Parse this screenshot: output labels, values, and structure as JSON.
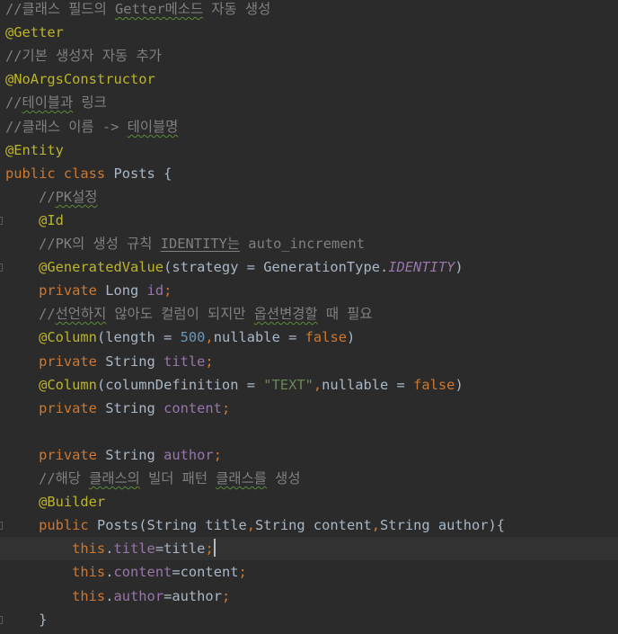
{
  "editor": {
    "theme": {
      "background": "#2b2b2b",
      "current_line": "#323232"
    },
    "lines": [
      {
        "parts": [
          {
            "c": "cm",
            "t": "//클래스 필드의 "
          },
          {
            "c": "cm typo",
            "t": "Getter메소드"
          },
          {
            "c": "cm",
            "t": " 자동 생성"
          }
        ]
      },
      {
        "parts": [
          {
            "c": "an",
            "t": "@Getter"
          }
        ]
      },
      {
        "parts": [
          {
            "c": "cm",
            "t": "//기본 생성자 자동 추가"
          }
        ]
      },
      {
        "parts": [
          {
            "c": "an",
            "t": "@NoArgsConstructor"
          }
        ]
      },
      {
        "parts": [
          {
            "c": "cm",
            "t": "//"
          },
          {
            "c": "cm typo",
            "t": "테이블과"
          },
          {
            "c": "cm",
            "t": " 링크"
          }
        ]
      },
      {
        "parts": [
          {
            "c": "cm",
            "t": "//클래스 이름 -> "
          },
          {
            "c": "cm typo",
            "t": "테이블명"
          }
        ]
      },
      {
        "parts": [
          {
            "c": "an",
            "t": "@Entity"
          }
        ]
      },
      {
        "parts": [
          {
            "c": "kw",
            "t": "public class "
          },
          {
            "c": "pl",
            "t": "Posts {"
          }
        ]
      },
      {
        "parts": [
          {
            "c": "cm",
            "t": "    //"
          },
          {
            "c": "cm typo",
            "t": "PK설정"
          }
        ]
      },
      {
        "gutter": true,
        "parts": [
          {
            "c": "an",
            "t": "    @Id"
          }
        ]
      },
      {
        "parts": [
          {
            "c": "cm",
            "t": "    //PK의 생성 규칙 "
          },
          {
            "c": "cm un",
            "t": "IDENTITY는"
          },
          {
            "c": "cm",
            "t": " auto_increment"
          }
        ]
      },
      {
        "gutter": true,
        "parts": [
          {
            "c": "an",
            "t": "    @GeneratedValue"
          },
          {
            "c": "pl",
            "t": "(strategy = GenerationType."
          },
          {
            "c": "it",
            "t": "IDENTITY"
          },
          {
            "c": "pl",
            "t": ")"
          }
        ]
      },
      {
        "parts": [
          {
            "c": "kw",
            "t": "    private "
          },
          {
            "c": "pl",
            "t": "Long "
          },
          {
            "c": "fd",
            "t": "id"
          },
          {
            "c": "kw",
            "t": ";"
          }
        ]
      },
      {
        "parts": [
          {
            "c": "cm",
            "t": "    //"
          },
          {
            "c": "cm typo",
            "t": "선언하지"
          },
          {
            "c": "cm",
            "t": " 않아도 컬럼이 되지만 "
          },
          {
            "c": "cm typo",
            "t": "옵션변경할"
          },
          {
            "c": "cm",
            "t": " 때 필요"
          }
        ]
      },
      {
        "parts": [
          {
            "c": "an",
            "t": "    @Column"
          },
          {
            "c": "pl",
            "t": "(length = "
          },
          {
            "c": "nu",
            "t": "500"
          },
          {
            "c": "kw",
            "t": ","
          },
          {
            "c": "pl",
            "t": "nullable = "
          },
          {
            "c": "kw",
            "t": "false"
          },
          {
            "c": "pl",
            "t": ")"
          }
        ]
      },
      {
        "parts": [
          {
            "c": "kw",
            "t": "    private "
          },
          {
            "c": "pl",
            "t": "String "
          },
          {
            "c": "fd",
            "t": "title"
          },
          {
            "c": "kw",
            "t": ";"
          }
        ]
      },
      {
        "parts": [
          {
            "c": "an",
            "t": "    @Column"
          },
          {
            "c": "pl",
            "t": "(columnDefinition = "
          },
          {
            "c": "st",
            "t": "\"TEXT\""
          },
          {
            "c": "kw",
            "t": ","
          },
          {
            "c": "pl",
            "t": "nullable = "
          },
          {
            "c": "kw",
            "t": "false"
          },
          {
            "c": "pl",
            "t": ")"
          }
        ]
      },
      {
        "parts": [
          {
            "c": "kw",
            "t": "    private "
          },
          {
            "c": "pl",
            "t": "String "
          },
          {
            "c": "fd",
            "t": "content"
          },
          {
            "c": "kw",
            "t": ";"
          }
        ]
      },
      {
        "parts": []
      },
      {
        "parts": [
          {
            "c": "kw",
            "t": "    private "
          },
          {
            "c": "pl",
            "t": "String "
          },
          {
            "c": "fd",
            "t": "author"
          },
          {
            "c": "kw",
            "t": ";"
          }
        ]
      },
      {
        "parts": [
          {
            "c": "cm",
            "t": "    //해당 "
          },
          {
            "c": "cm typo",
            "t": "클래스의"
          },
          {
            "c": "cm",
            "t": " 빌더 패턴 "
          },
          {
            "c": "cm typo",
            "t": "클래스를"
          },
          {
            "c": "cm",
            "t": " 생성"
          }
        ]
      },
      {
        "parts": [
          {
            "c": "an",
            "t": "    @Builder"
          }
        ]
      },
      {
        "gutter": true,
        "parts": [
          {
            "c": "kw",
            "t": "    public "
          },
          {
            "c": "pl",
            "t": "Posts(String title"
          },
          {
            "c": "kw",
            "t": ","
          },
          {
            "c": "pl",
            "t": "String content"
          },
          {
            "c": "kw",
            "t": ","
          },
          {
            "c": "pl",
            "t": "String author){"
          }
        ]
      },
      {
        "current": true,
        "caret": true,
        "parts": [
          {
            "c": "kw",
            "t": "        this"
          },
          {
            "c": "pl",
            "t": "."
          },
          {
            "c": "fd",
            "t": "title"
          },
          {
            "c": "pl",
            "t": "=title"
          },
          {
            "c": "kw",
            "t": ";"
          }
        ]
      },
      {
        "parts": [
          {
            "c": "kw",
            "t": "        this"
          },
          {
            "c": "pl",
            "t": "."
          },
          {
            "c": "fd",
            "t": "content"
          },
          {
            "c": "pl",
            "t": "=content"
          },
          {
            "c": "kw",
            "t": ";"
          }
        ]
      },
      {
        "parts": [
          {
            "c": "kw",
            "t": "        this"
          },
          {
            "c": "pl",
            "t": "."
          },
          {
            "c": "fd",
            "t": "author"
          },
          {
            "c": "pl",
            "t": "=author"
          },
          {
            "c": "kw",
            "t": ";"
          }
        ]
      },
      {
        "gutter": true,
        "parts": [
          {
            "c": "pl",
            "t": "    }"
          }
        ]
      }
    ]
  }
}
